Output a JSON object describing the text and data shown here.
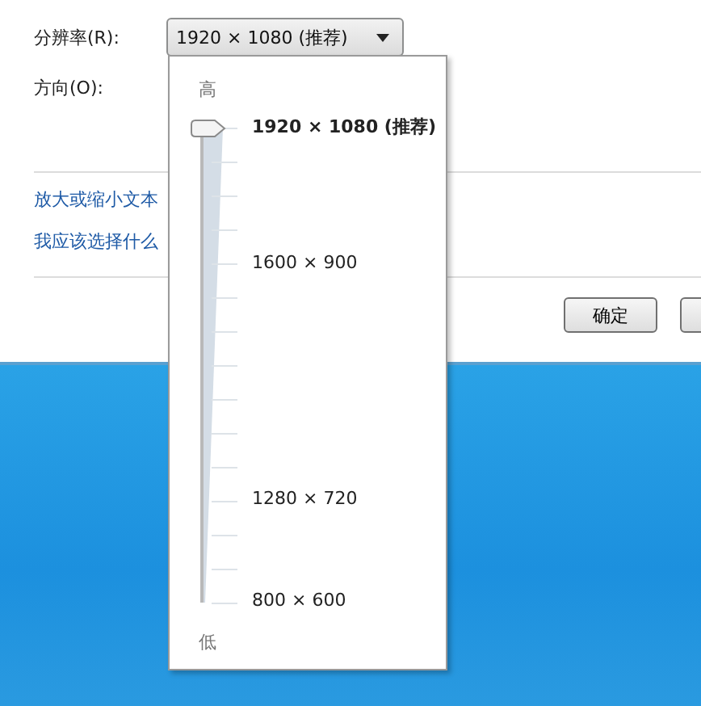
{
  "resolution": {
    "label": "分辨率(R):",
    "value": "1920 × 1080 (推荐)"
  },
  "orientation": {
    "label": "方向(O):"
  },
  "links": [
    "放大或缩小文本",
    "我应该选择什么"
  ],
  "buttons": [
    "确定"
  ],
  "popup": {
    "high_label": "高",
    "low_label": "低",
    "level": 1,
    "options": [
      {
        "label": "1920 × 1080 (推荐)",
        "selected": true
      },
      {
        "label": "1600 × 900",
        "selected": false
      },
      {
        "label": "1280 × 720",
        "selected": false
      },
      {
        "label": "800 × 600",
        "selected": false
      }
    ]
  }
}
